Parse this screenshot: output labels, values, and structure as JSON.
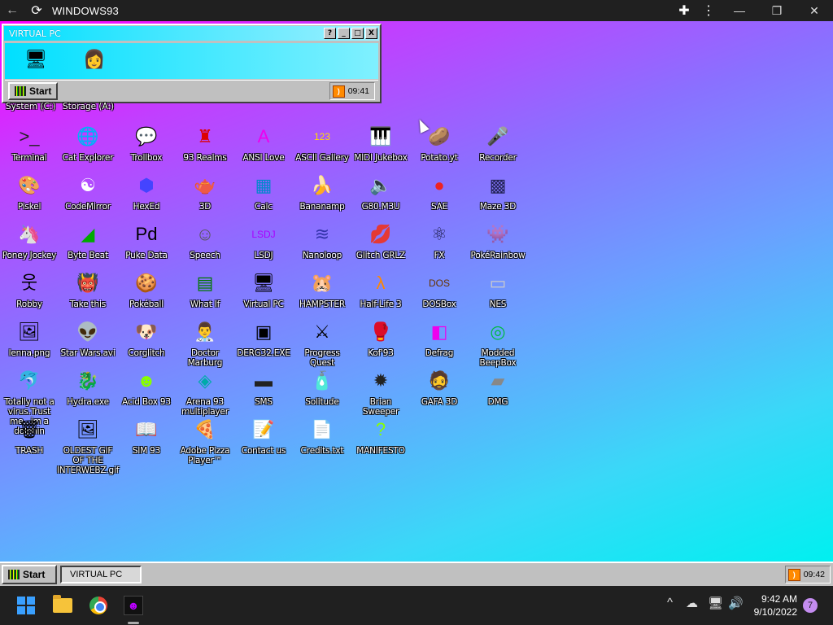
{
  "browser": {
    "title": "WINDOWS93",
    "back_icon": "←",
    "reload_icon": "⟳",
    "extension_icon": "✚",
    "menu_icon": "⋮",
    "minimize": "—",
    "restore": "❐",
    "close": "✕"
  },
  "vpc_window": {
    "title": "VIRTUAL PC",
    "help": "?",
    "min": "_",
    "max": "□",
    "close": "X",
    "start_label": "Start",
    "clock": "09:41",
    "drives": [
      "System (C:)",
      "Storage (A:)"
    ]
  },
  "icons": [
    {
      "label": "Terminal",
      "glyph": ">_",
      "color": "#222"
    },
    {
      "label": "Cat Explorer",
      "glyph": "🌐",
      "color": "#000"
    },
    {
      "label": "Trollbox",
      "glyph": "💬",
      "color": "#000"
    },
    {
      "label": "93 Realms",
      "glyph": "♜",
      "color": "#d00"
    },
    {
      "label": "ANSI Love",
      "glyph": "A",
      "color": "#e0e"
    },
    {
      "label": "ASCII Gallery",
      "glyph": "123",
      "color": "#fd0"
    },
    {
      "label": "MIDI Jukebox",
      "glyph": "🎹",
      "color": "#000"
    },
    {
      "label": "Potato.yt",
      "glyph": "🥔",
      "color": "#000"
    },
    {
      "label": "Recorder",
      "glyph": "🎤",
      "color": "#000"
    },
    {
      "label": "Piskel",
      "glyph": "🎨",
      "color": "#000"
    },
    {
      "label": "CodeMirror",
      "glyph": "☯",
      "color": "#fff"
    },
    {
      "label": "HexEd",
      "glyph": "⬢",
      "color": "#44f"
    },
    {
      "label": "3D",
      "glyph": "🫖",
      "color": "#000"
    },
    {
      "label": "Calc",
      "glyph": "▦",
      "color": "#08c"
    },
    {
      "label": "Bananamp",
      "glyph": "🍌",
      "color": "#000"
    },
    {
      "label": "G80.M3U",
      "glyph": "🔈",
      "color": "#000"
    },
    {
      "label": "SAE",
      "glyph": "●",
      "color": "#e22"
    },
    {
      "label": "Maze 3D",
      "glyph": "▩",
      "color": "#225"
    },
    {
      "label": "Poney Jockey",
      "glyph": "🦄",
      "color": "#000"
    },
    {
      "label": "Byte Beat",
      "glyph": "◢",
      "color": "#0a0"
    },
    {
      "label": "Puke Data",
      "glyph": "Pd",
      "color": "#000"
    },
    {
      "label": "Speech",
      "glyph": "☺",
      "color": "#555"
    },
    {
      "label": "LSDJ",
      "glyph": "LSDJ",
      "color": "#a0f"
    },
    {
      "label": "Nanoloop",
      "glyph": "≋",
      "color": "#33a"
    },
    {
      "label": "Glitch GRLZ",
      "glyph": "💋",
      "color": "#000"
    },
    {
      "label": "FX",
      "glyph": "⚛",
      "color": "#225"
    },
    {
      "label": "PokéRainbow",
      "glyph": "👾",
      "color": "#000"
    },
    {
      "label": "Robby",
      "glyph": "웃",
      "color": "#000"
    },
    {
      "label": "Take this",
      "glyph": "👹",
      "color": "#000"
    },
    {
      "label": "Pokéball",
      "glyph": "🍪",
      "color": "#000"
    },
    {
      "label": "What If",
      "glyph": "▤",
      "color": "#070"
    },
    {
      "label": "Virtual PC",
      "glyph": "🖥",
      "color": "#000"
    },
    {
      "label": "HAMPSTER",
      "glyph": "🐹",
      "color": "#000"
    },
    {
      "label": "Half-Life 3",
      "glyph": "λ",
      "color": "#f80"
    },
    {
      "label": "DOSBox",
      "glyph": "DOS",
      "color": "#630"
    },
    {
      "label": "NES",
      "glyph": "▭",
      "color": "#ccc"
    },
    {
      "label": "lenna.png",
      "glyph": "🖼",
      "color": "#000"
    },
    {
      "label": "Star Wars.avi",
      "glyph": "👽",
      "color": "#000"
    },
    {
      "label": "Corglitch",
      "glyph": "🐶",
      "color": "#000"
    },
    {
      "label": "Doctor Marburg",
      "glyph": "👨‍⚕",
      "color": "#000"
    },
    {
      "label": "DERG32.EXE",
      "glyph": "▣",
      "color": "#000"
    },
    {
      "label": "Progress Quest",
      "glyph": "⚔",
      "color": "#000"
    },
    {
      "label": "Kof'93",
      "glyph": "🥊",
      "color": "#000"
    },
    {
      "label": "Defrag",
      "glyph": "◧",
      "color": "#e0e"
    },
    {
      "label": "Modded BeepBox",
      "glyph": "◎",
      "color": "#0b4"
    },
    {
      "label": "Totally not a virus.Trust me...im a dolphin",
      "glyph": "🐬",
      "color": "#000"
    },
    {
      "label": "Hydra.exe",
      "glyph": "🐉",
      "color": "#000"
    },
    {
      "label": "Acid Box 93",
      "glyph": "☻",
      "color": "#8f0"
    },
    {
      "label": "Arena 93 multiplayer",
      "glyph": "◈",
      "color": "#0aa"
    },
    {
      "label": "SMS",
      "glyph": "▬",
      "color": "#222"
    },
    {
      "label": "Solitude",
      "glyph": "🧴",
      "color": "#000"
    },
    {
      "label": "Brian Sweeper",
      "glyph": "✹",
      "color": "#222"
    },
    {
      "label": "GAFA 3D",
      "glyph": "🧔",
      "color": "#000"
    },
    {
      "label": "DMG",
      "glyph": "▰",
      "color": "#888"
    },
    {
      "label": "TRASH",
      "glyph": "🗑",
      "color": "#000"
    },
    {
      "label": "OLDEST GIF OF THE INTERWEBZ.gif",
      "glyph": "🖼",
      "color": "#000"
    },
    {
      "label": "SIM 93",
      "glyph": "📖",
      "color": "#000"
    },
    {
      "label": "Adobe Pizza Player™",
      "glyph": "🍕",
      "color": "#000"
    },
    {
      "label": "Contact us",
      "glyph": "📝",
      "color": "#000"
    },
    {
      "label": "Credits.txt",
      "glyph": "📄",
      "color": "#000"
    },
    {
      "label": "MANIFESTO",
      "glyph": "?",
      "color": "#8f0"
    }
  ],
  "w93_taskbar": {
    "start_label": "Start",
    "task_item": "VIRTUAL PC",
    "clock": "09:42"
  },
  "windows_taskbar": {
    "time": "9:42 AM",
    "date": "9/10/2022",
    "notifications": "7",
    "chevron": "^",
    "cloud_icon": "☁",
    "network_icon": "🖥",
    "volume_icon": "🔊"
  },
  "colors": {
    "desktop_gradient_start": "#ff00ff",
    "desktop_gradient_end": "#00f0f0",
    "window_gray": "#c0c0c0",
    "titlebar_cyan": "#00e0ff"
  }
}
